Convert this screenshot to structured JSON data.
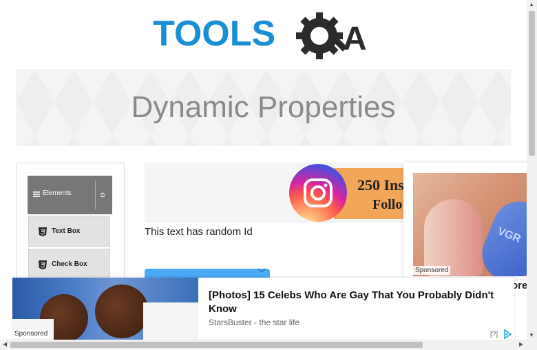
{
  "logo": {
    "text": "TOOLS",
    "suffix": "A",
    "brand_color": "#1a8fd6",
    "dark_color": "#2b2b2b"
  },
  "page": {
    "title": "Dynamic Properties"
  },
  "sidebar": {
    "group_label": "Elements",
    "items": [
      {
        "label": "Text Box"
      },
      {
        "label": "Check Box"
      }
    ]
  },
  "main": {
    "random_id_text": "This text has random Id"
  },
  "ads": {
    "instagram_banner": {
      "line1": "250 Inst",
      "line2": "Follo"
    },
    "right_ad": {
      "sponsored": "Sponsored",
      "pill_text": "VGR",
      "cut_text": "ore"
    },
    "bottom_ad": {
      "headline": "[Photos] 15 Celebs Who Are Gay That You Probably Didn't Know",
      "source": "StarsBuster - the star life",
      "sponsored": "Sponsored",
      "help": "[?]"
    }
  },
  "colors": {
    "accent": "#1a8fd6",
    "menu_header": "#777777",
    "blue_button": "#4aa8f5"
  }
}
